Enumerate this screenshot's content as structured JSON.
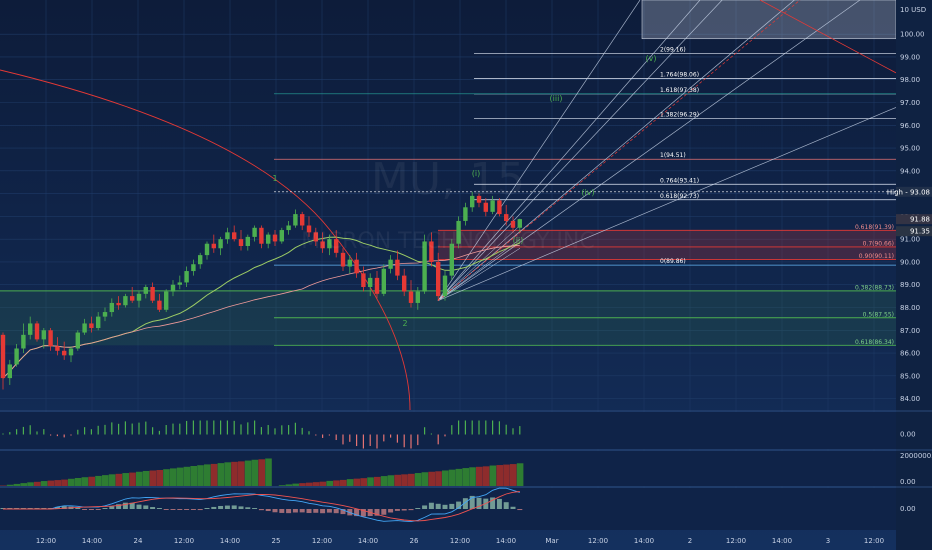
{
  "chart_data": {
    "type": "candlestick",
    "watermark_symbol": "MU, 15",
    "watermark_name": "MICRON TECHNOLOGY INC",
    "currency": "USD",
    "y_axis": {
      "min": 83.5,
      "max": 101.5,
      "ticks": [
        "84.00",
        "85.00",
        "86.00",
        "87.00",
        "88.00",
        "89.00",
        "90.00",
        "91.00",
        "92.00",
        "93.00",
        "94.00",
        "95.00",
        "96.00",
        "97.00",
        "98.00",
        "99.00",
        "100.00"
      ],
      "top_label": "10 USD"
    },
    "x_axis_ticks": [
      "12:00",
      "14:00",
      "24",
      "12:00",
      "14:00",
      "25",
      "12:00",
      "14:00",
      "26",
      "12:00",
      "14:00",
      "Mar",
      "12:00",
      "14:00",
      "2",
      "12:00",
      "14:00",
      "3",
      "12:00"
    ],
    "price_badges": [
      {
        "text": "High - 93.08",
        "value": 93.08,
        "color": "#ffffff",
        "bg": "#20304a"
      },
      {
        "text": "91.88",
        "value": 91.88,
        "color": "#ffffff",
        "bg": "#333344"
      },
      {
        "text": "91.35",
        "value": 91.35,
        "color": "#ffffff",
        "bg": "#2a3444"
      }
    ],
    "candles": [
      [
        86.8,
        86.9,
        84.4,
        84.9
      ],
      [
        84.9,
        85.7,
        84.6,
        85.5
      ],
      [
        85.5,
        86.4,
        85.4,
        86.2
      ],
      [
        86.2,
        87.3,
        86.0,
        86.8
      ],
      [
        86.8,
        87.6,
        86.6,
        87.3
      ],
      [
        87.3,
        87.4,
        86.5,
        86.6
      ],
      [
        86.6,
        87.1,
        86.2,
        87.0
      ],
      [
        87.0,
        87.1,
        86.1,
        86.3
      ],
      [
        86.3,
        86.7,
        85.9,
        86.1
      ],
      [
        86.1,
        86.5,
        85.7,
        85.9
      ],
      [
        85.9,
        86.3,
        85.6,
        86.2
      ],
      [
        86.2,
        87.0,
        86.1,
        86.9
      ],
      [
        86.9,
        87.5,
        86.8,
        87.3
      ],
      [
        87.3,
        87.6,
        86.9,
        87.1
      ],
      [
        87.1,
        87.8,
        87.0,
        87.6
      ],
      [
        87.6,
        88.0,
        87.4,
        87.8
      ],
      [
        87.8,
        88.4,
        87.6,
        88.2
      ],
      [
        88.2,
        88.5,
        87.9,
        88.1
      ],
      [
        88.1,
        88.6,
        88.0,
        88.5
      ],
      [
        88.5,
        88.9,
        88.2,
        88.3
      ],
      [
        88.3,
        88.7,
        88.0,
        88.6
      ],
      [
        88.6,
        89.0,
        88.4,
        88.9
      ],
      [
        88.9,
        89.1,
        88.2,
        88.3
      ],
      [
        88.3,
        88.6,
        87.8,
        87.9
      ],
      [
        87.9,
        88.8,
        87.8,
        88.7
      ],
      [
        88.7,
        89.2,
        88.5,
        89.0
      ],
      [
        89.0,
        89.4,
        88.8,
        89.1
      ],
      [
        89.1,
        89.8,
        88.9,
        89.6
      ],
      [
        89.6,
        90.1,
        89.4,
        89.9
      ],
      [
        89.9,
        90.4,
        89.7,
        90.3
      ],
      [
        90.3,
        90.9,
        90.1,
        90.8
      ],
      [
        90.8,
        91.2,
        90.4,
        90.6
      ],
      [
        90.6,
        91.1,
        90.3,
        91.0
      ],
      [
        91.0,
        91.5,
        90.8,
        91.3
      ],
      [
        91.3,
        91.6,
        90.9,
        91.0
      ],
      [
        91.0,
        91.4,
        90.5,
        90.7
      ],
      [
        90.7,
        91.2,
        90.5,
        91.1
      ],
      [
        91.1,
        91.6,
        90.9,
        91.5
      ],
      [
        91.5,
        91.6,
        90.6,
        90.8
      ],
      [
        90.8,
        91.3,
        90.6,
        91.2
      ],
      [
        91.2,
        91.4,
        90.7,
        90.9
      ],
      [
        90.9,
        91.5,
        90.8,
        91.4
      ],
      [
        91.4,
        91.8,
        91.2,
        91.6
      ],
      [
        91.6,
        92.3,
        91.5,
        92.1
      ],
      [
        92.1,
        92.2,
        91.4,
        91.6
      ],
      [
        91.6,
        92.0,
        91.1,
        91.3
      ],
      [
        91.3,
        91.5,
        90.7,
        90.9
      ],
      [
        90.9,
        91.3,
        90.4,
        90.6
      ],
      [
        90.6,
        91.2,
        90.3,
        91.0
      ],
      [
        91.0,
        91.4,
        90.2,
        90.4
      ],
      [
        90.4,
        90.6,
        89.6,
        89.8
      ],
      [
        89.8,
        90.3,
        89.5,
        90.1
      ],
      [
        90.1,
        90.4,
        89.3,
        89.5
      ],
      [
        89.5,
        89.8,
        88.7,
        88.9
      ],
      [
        88.9,
        89.5,
        88.5,
        89.3
      ],
      [
        89.3,
        89.6,
        88.4,
        88.6
      ],
      [
        88.6,
        89.9,
        88.5,
        89.7
      ],
      [
        89.7,
        90.3,
        89.5,
        90.1
      ],
      [
        90.1,
        90.5,
        89.2,
        89.4
      ],
      [
        89.4,
        89.7,
        88.5,
        88.7
      ],
      [
        88.7,
        89.2,
        88.0,
        88.2
      ],
      [
        88.2,
        88.9,
        87.9,
        88.7
      ],
      [
        88.7,
        91.2,
        88.6,
        90.9
      ],
      [
        90.9,
        91.3,
        89.8,
        90.0
      ],
      [
        90.0,
        90.4,
        88.3,
        88.5
      ],
      [
        88.5,
        89.6,
        88.3,
        89.4
      ],
      [
        89.4,
        91.0,
        89.2,
        90.8
      ],
      [
        90.8,
        92.0,
        90.6,
        91.8
      ],
      [
        91.8,
        92.6,
        91.6,
        92.4
      ],
      [
        92.4,
        93.08,
        92.2,
        92.9
      ],
      [
        92.9,
        93.0,
        92.4,
        92.6
      ],
      [
        92.6,
        92.8,
        92.0,
        92.2
      ],
      [
        92.2,
        92.9,
        92.1,
        92.7
      ],
      [
        92.7,
        92.8,
        92.0,
        92.1
      ],
      [
        92.1,
        92.5,
        91.6,
        91.8
      ],
      [
        91.8,
        92.0,
        91.3,
        91.5
      ],
      [
        91.5,
        91.9,
        91.3,
        91.88
      ]
    ],
    "fib_retracement": [
      {
        "label": "0.382(88.73)",
        "value": 88.73,
        "color": "#4caf50"
      },
      {
        "label": "0.5(87.55)",
        "value": 87.55,
        "color": "#4caf50"
      },
      {
        "label": "0.618(86.34)",
        "value": 86.34,
        "color": "#4caf50"
      },
      {
        "label": "0.618(91.39)",
        "value": 91.39,
        "color": "#e53935"
      },
      {
        "label": "0.7(90.66)",
        "value": 90.66,
        "color": "#e53935"
      },
      {
        "label": "0.90(90.11)",
        "value": 90.11,
        "color": "#e53935"
      }
    ],
    "fib_extension": [
      {
        "label": "2(99.16)",
        "value": 99.16
      },
      {
        "label": "1.764(98.06)",
        "value": 98.06
      },
      {
        "label": "1.618(97.38)",
        "value": 97.38
      },
      {
        "label": "1.382(96.29)",
        "value": 96.29
      },
      {
        "label": "1(94.51)",
        "value": 94.51
      },
      {
        "label": "0.764(93.41)",
        "value": 93.41
      },
      {
        "label": "0.618(92.73)",
        "value": 92.73
      },
      {
        "label": "0(89.86)",
        "value": 89.86
      }
    ],
    "wave_labels": [
      {
        "text": "1",
        "color": "#4caf50"
      },
      {
        "text": "2",
        "color": "#4caf50"
      },
      {
        "text": "(i)",
        "color": "#4caf50"
      },
      {
        "text": "(ii)",
        "color": "#4caf50"
      },
      {
        "text": "(iii)",
        "color": "#4caf50"
      },
      {
        "text": "(iv)",
        "color": "#4caf50"
      },
      {
        "text": "(v)",
        "color": "#4caf50"
      }
    ],
    "panels": [
      {
        "name": "momentum histogram",
        "axis_label": "0.00"
      },
      {
        "name": "cumulative volume",
        "axis_labels": [
          "2000000.00",
          "0.00"
        ]
      },
      {
        "name": "macd",
        "axis_label": "0.00"
      }
    ],
    "colors": {
      "up": "#4caf50",
      "down": "#e53935",
      "background": "#12284f",
      "grid": "#1e3a66"
    }
  }
}
